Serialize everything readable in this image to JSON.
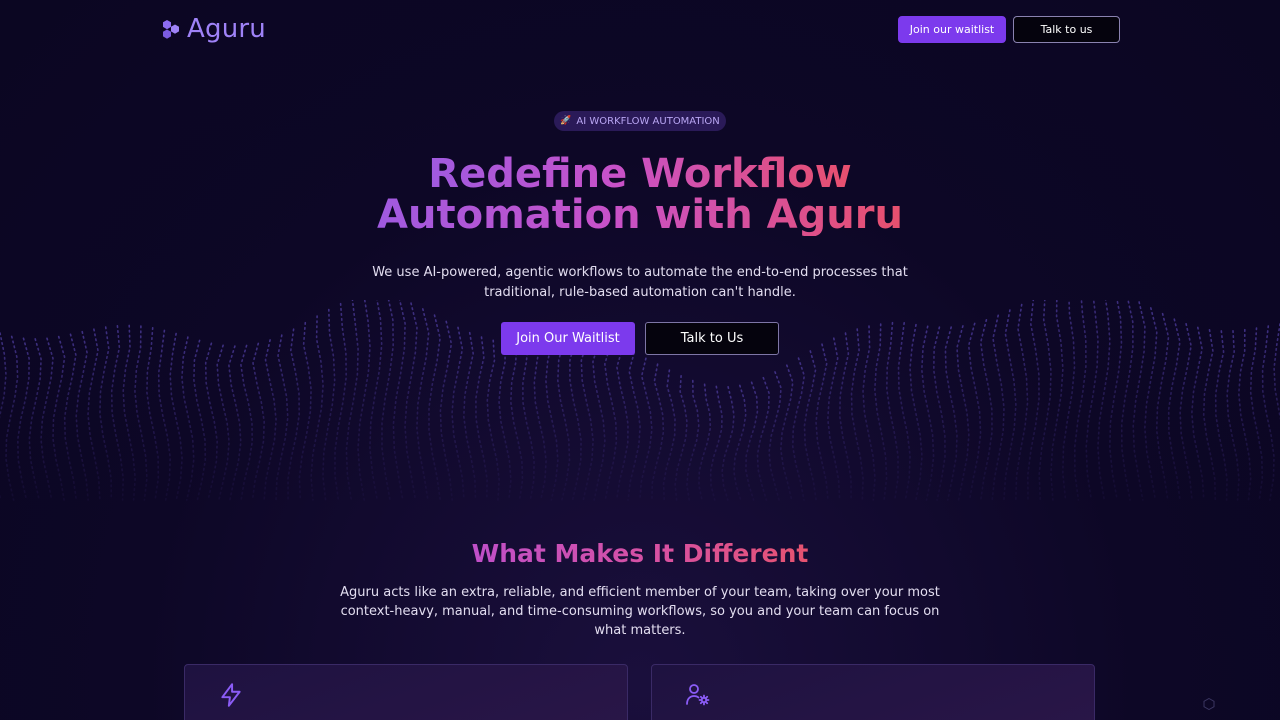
{
  "brand": {
    "name": "Aguru",
    "color": "#9f82f7"
  },
  "header": {
    "waitlist_label": "Join our waitlist",
    "talk_label": "Talk to us"
  },
  "hero": {
    "badge_icon": "rocket-icon",
    "badge_text": "AI WORKFLOW AUTOMATION",
    "title_line1": "Redefine Workflow",
    "title_line2": "Automation with Aguru",
    "subtitle": "We use AI-powered, agentic workflows to automate the end-to-end processes that traditional, rule-based automation can't handle.",
    "primary_cta": "Join Our Waitlist",
    "secondary_cta": "Talk to Us"
  },
  "features": {
    "title": "What Makes It Different",
    "description": "Aguru acts like an extra, reliable, and efficient member of your team, taking over your most context-heavy, manual, and time-consuming workflows, so you and your team can focus on what matters.",
    "cards": [
      {
        "icon": "lightning-icon"
      },
      {
        "icon": "user-settings-icon"
      }
    ]
  },
  "colors": {
    "accent": "#7c3aed",
    "background": "#0b0622",
    "gradient_start": "#a05ae0",
    "gradient_end": "#e8506d"
  }
}
